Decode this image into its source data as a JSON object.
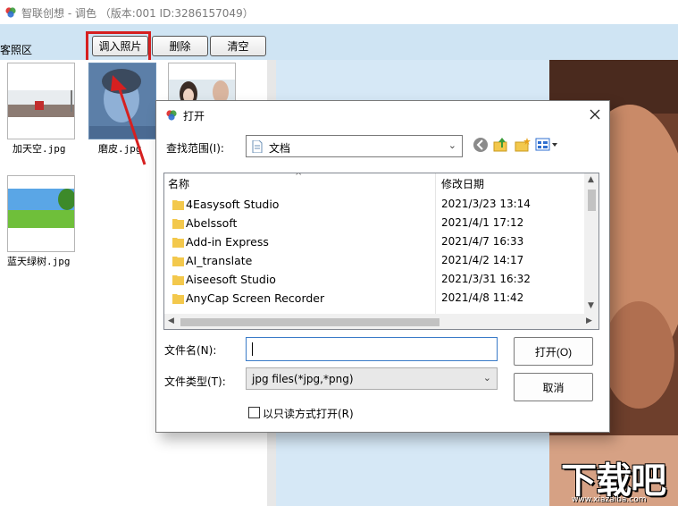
{
  "window": {
    "title": "智联创想 - 调色 （版本:001  ID:3286157049）"
  },
  "toolbar": {
    "import_label": "调入照片",
    "delete_label": "删除",
    "clear_label": "清空"
  },
  "sidebar": {
    "label": "客照区"
  },
  "thumbnails": [
    {
      "caption": "加天空.jpg"
    },
    {
      "caption": "磨皮.jpg"
    },
    {
      "caption": ""
    },
    {
      "caption": "蓝天绿树.jpg"
    }
  ],
  "watermark": {
    "brand": "下载吧",
    "url": "www.xiazaiba.com"
  },
  "dialog": {
    "title": "打开",
    "lookin_label": "查找范围(I):",
    "lookin_value": "文档",
    "columns": {
      "name": "名称",
      "modified": "修改日期"
    },
    "rows": [
      {
        "name": "4Easysoft Studio",
        "date": "2021/3/23 13:14"
      },
      {
        "name": "Abelssoft",
        "date": "2021/4/1 17:12"
      },
      {
        "name": "Add-in Express",
        "date": "2021/4/7 16:33"
      },
      {
        "name": "AI_translate",
        "date": "2021/4/2 14:17"
      },
      {
        "name": "Aiseesoft Studio",
        "date": "2021/3/31 16:32"
      },
      {
        "name": "AnyCap Screen Recorder",
        "date": "2021/4/8 11:42"
      }
    ],
    "filename_label": "文件名(N):",
    "filename_value": "",
    "filetype_label": "文件类型(T):",
    "filetype_value": "jpg files(*jpg,*png)",
    "open_label": "打开(O)",
    "cancel_label": "取消",
    "readonly_label": "以只读方式打开(R)"
  },
  "colors": {
    "toolband": "#cfe4f3",
    "highlight": "#d62020",
    "focus": "#3a7bc8",
    "folder": "#f3c84c"
  }
}
